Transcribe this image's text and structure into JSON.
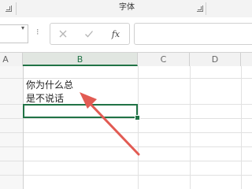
{
  "ribbon": {
    "font_group_label": "字体"
  },
  "formula_bar": {
    "more_symbol": "⁝",
    "cancel_icon": "cancel-x-icon",
    "enter_icon": "checkmark-icon",
    "fx_label": "fx",
    "value": ""
  },
  "columns": {
    "headers": [
      "A",
      "B",
      "C",
      "D"
    ],
    "selected": "B"
  },
  "cell": {
    "line1": "你为什么总",
    "line2": "是不说话"
  },
  "colors": {
    "accent": "#217346",
    "arrow": "#e25b53"
  }
}
